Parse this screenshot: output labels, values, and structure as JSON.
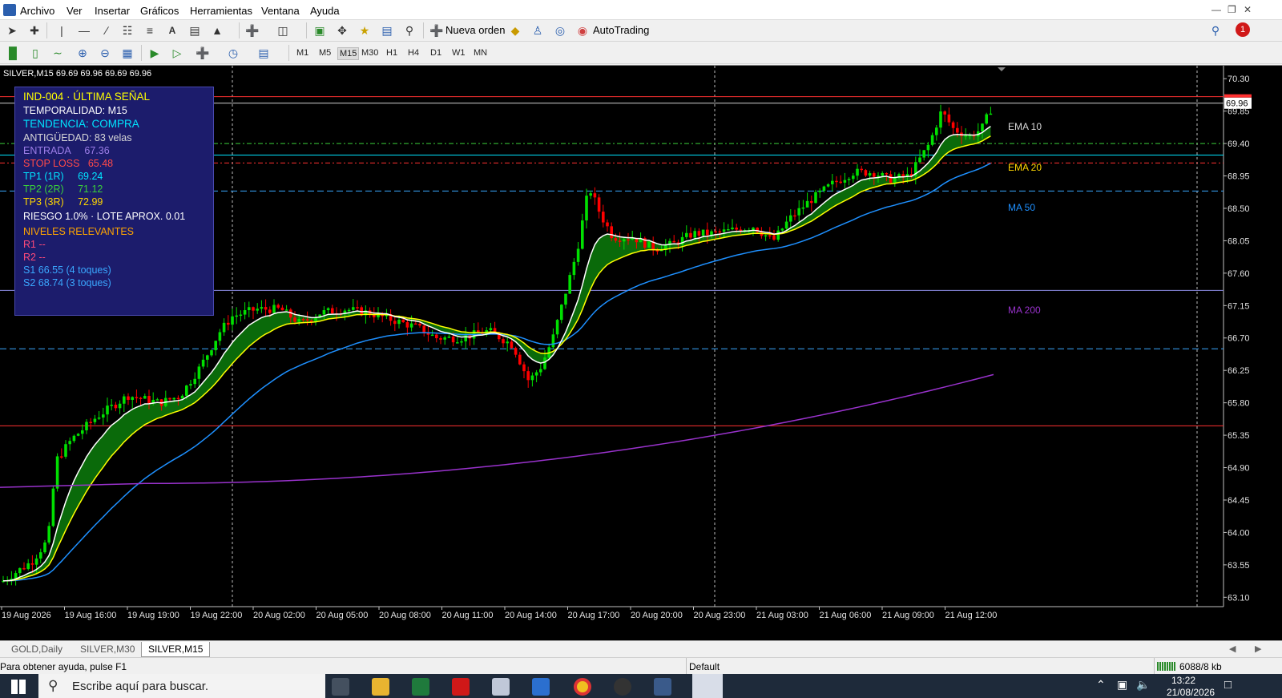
{
  "menu": [
    "Archivo",
    "Ver",
    "Insertar",
    "Gráficos",
    "Herramientas",
    "Ventana",
    "Ayuda"
  ],
  "toolbar": {
    "new_order": "Nueva orden",
    "autotrading": "AutoTrading",
    "notification_count": "1",
    "timeframes": [
      "M1",
      "M5",
      "M15",
      "M30",
      "H1",
      "H4",
      "D1",
      "W1",
      "MN"
    ],
    "active_timeframe": "M15"
  },
  "chart": {
    "symbol_header": "SILVER,M15  69.69 69.96 69.69 69.96",
    "y_ticks": [
      "70.30",
      "69.85",
      "69.40",
      "68.95",
      "68.50",
      "68.05",
      "67.60",
      "67.15",
      "66.70",
      "66.25",
      "65.80",
      "65.35",
      "64.90",
      "64.45",
      "64.00",
      "63.55",
      "63.10"
    ],
    "x_ticks": [
      "19 Aug 2026",
      "19 Aug 16:00",
      "19 Aug 19:00",
      "19 Aug 22:00",
      "20 Aug 02:00",
      "20 Aug 05:00",
      "20 Aug 08:00",
      "20 Aug 11:00",
      "20 Aug 14:00",
      "20 Aug 17:00",
      "20 Aug 20:00",
      "20 Aug 23:00",
      "21 Aug 03:00",
      "21 Aug 06:00",
      "21 Aug 09:00",
      "21 Aug 12:00"
    ],
    "current_price": "69.96",
    "labels": {
      "ema10": "EMA 10",
      "ema20": "EMA 20",
      "ma50": "MA 50",
      "ma200": "MA 200"
    },
    "colors": {
      "bull": "#00e000",
      "bear": "#ff0000",
      "ema10": "#ffffff",
      "ema20": "#ffff00",
      "ma50": "#1e90ff",
      "ma200": "#9932cc"
    }
  },
  "signal": {
    "title": "IND-004 · ÚLTIMA SEÑAL",
    "timeframe": "TEMPORALIDAD: M15",
    "trend": "TENDENCIA: COMPRA",
    "age": "ANTIGÜEDAD: 83 velas",
    "entry": "ENTRADA     67.36",
    "stop": "STOP LOSS   65.48",
    "tp1": "TP1 (1R)     69.24",
    "tp2": "TP2 (2R)     71.12",
    "tp3": "TP3 (3R)     72.99",
    "risk": "RIESGO 1.0% · LOTE APROX. 0.01",
    "levels_title": "NIVELES RELEVANTES",
    "r1": "R1  --",
    "r2": "R2  --",
    "s1": "S1  66.55 (4 toques)",
    "s2": "S2  68.74 (3 toques)"
  },
  "tabs": [
    "GOLD,Daily",
    "SILVER,M30",
    "SILVER,M15"
  ],
  "status": {
    "help": "Para obtener ayuda, pulse F1",
    "profile": "Default",
    "traffic": "6088/8 kb"
  },
  "taskbar": {
    "search_placeholder": "Escribe aquí para buscar.",
    "time": "13:22",
    "date": "21/08/2026"
  }
}
